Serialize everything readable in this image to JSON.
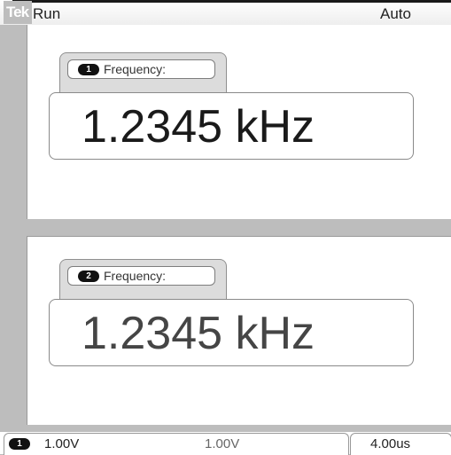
{
  "header": {
    "logo": "Tek",
    "run_state": "Run",
    "trigger_mode": "Auto"
  },
  "measurements": [
    {
      "channel": "1",
      "label": "Frequency:",
      "value": "1.2345 kHz"
    },
    {
      "channel": "2",
      "label": "Frequency:",
      "value": "1.2345 kHz"
    }
  ],
  "status": {
    "channel": "1",
    "ch1_scale": "1.00V",
    "ch2_scale": "1.00V",
    "timebase": "4.00us"
  },
  "colors": {
    "background": "#bdbdbd",
    "panel": "#ffffff",
    "badge": "#111111"
  }
}
